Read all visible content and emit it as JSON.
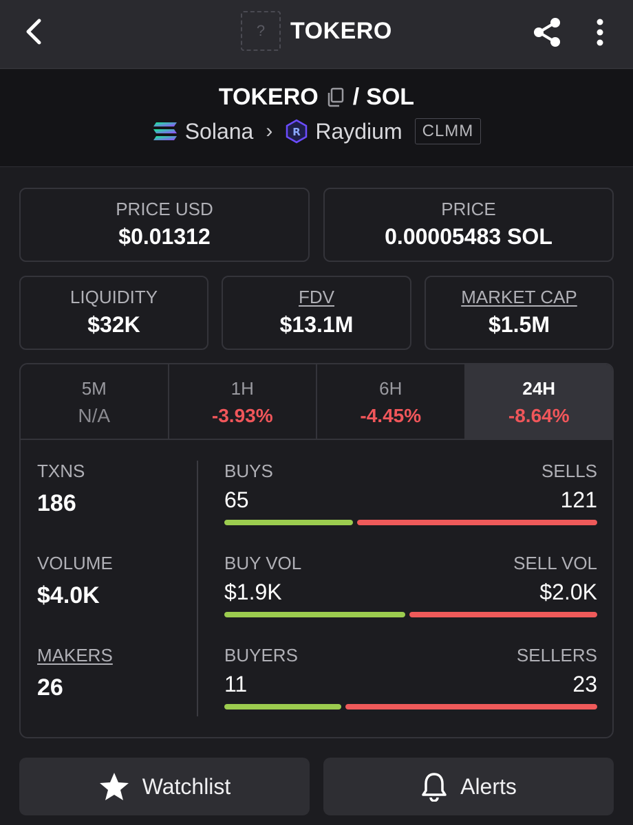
{
  "header": {
    "title": "TOKERO",
    "token_placeholder": "?",
    "back_icon": "chevron-left-icon",
    "share_icon": "share-icon",
    "menu_icon": "more-vertical-icon"
  },
  "pair": {
    "base": "TOKERO",
    "separator": "/",
    "quote": "SOL",
    "chain": "Solana",
    "dex": "Raydium",
    "pool_type": "CLMM"
  },
  "prices": {
    "price_usd_label": "PRICE USD",
    "price_usd": "$0.01312",
    "price_label": "PRICE",
    "price_native": "0.00005483 SOL"
  },
  "metrics": {
    "liquidity_label": "LIQUIDITY",
    "liquidity": "$32K",
    "fdv_label": "FDV",
    "fdv": "$13.1M",
    "mcap_label": "MARKET CAP",
    "mcap": "$1.5M"
  },
  "changes": [
    {
      "label": "5M",
      "value": "N/A"
    },
    {
      "label": "1H",
      "value": "-3.93%"
    },
    {
      "label": "6H",
      "value": "-4.45%"
    },
    {
      "label": "24H",
      "value": "-8.64%"
    }
  ],
  "stats": {
    "txns_label": "TXNS",
    "txns": "186",
    "volume_label": "VOLUME",
    "volume": "$4.0K",
    "makers_label": "MAKERS",
    "makers": "26",
    "buys_label": "BUYS",
    "buys": "65",
    "sells_label": "SELLS",
    "sells": "121",
    "buy_vol_label": "BUY VOL",
    "buy_vol": "$1.9K",
    "sell_vol_label": "SELL VOL",
    "sell_vol": "$2.0K",
    "buyers_label": "BUYERS",
    "buyers": "11",
    "sellers_label": "SELLERS",
    "sellers": "23",
    "ratios": {
      "buys": 0.35,
      "buy_vol": 0.49,
      "buyers": 0.32
    }
  },
  "actions": {
    "watchlist": "Watchlist",
    "alerts": "Alerts"
  },
  "colors": {
    "positive": "#9ccc4f",
    "negative": "#ef5a5a"
  }
}
